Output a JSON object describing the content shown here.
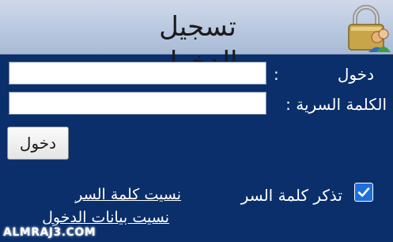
{
  "header": {
    "title": "تسجيل الدخول",
    "icon": "lock-users-icon"
  },
  "form": {
    "username_label": "دخول",
    "password_label": "الكلمة السرية :",
    "colon": ":",
    "username_value": "",
    "password_value": "",
    "login_button": "دخول",
    "remember_label": "تذكر كلمة السر",
    "remember_checked": true,
    "forgot_password_link": "نسيت كلمة السر",
    "forgot_login_link": "نسيت بيانات الدخول"
  },
  "watermark": "ALMRAJ3.COM",
  "colors": {
    "panel_background": "#0a2f6b",
    "header_background": "#c2cfe5",
    "checkbox_accent": "#1e6fd9"
  }
}
